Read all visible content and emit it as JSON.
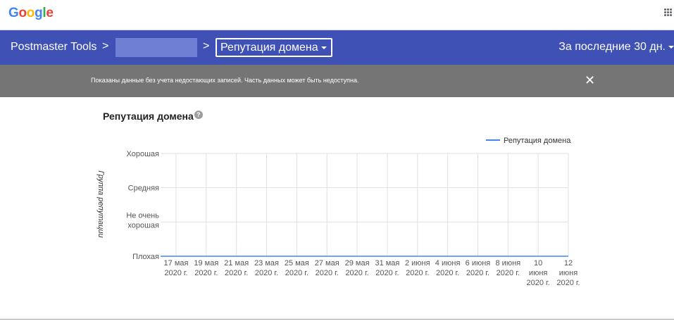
{
  "header": {
    "logo_text": "Google",
    "apps_icon": "apps-grid-icon"
  },
  "nav": {
    "app_name": "Postmaster Tools",
    "separator": ">",
    "domain_value": "",
    "section_label": "Репутация домена",
    "period_label": "За последние 30 дн."
  },
  "banner": {
    "message": "Показаны данные без учета недостающих записей. Часть данных может быть недоступна.",
    "close_symbol": "✕"
  },
  "chart_title": "Репутация домена",
  "help_symbol": "?",
  "chart_data": {
    "type": "line",
    "title": "Репутация домена",
    "ylabel": "Группа репутации",
    "xlabel": "",
    "legend": {
      "position": "top-right",
      "entries": [
        "Репутация домена"
      ]
    },
    "y_categories": [
      "Плохая",
      "Не очень хорошая",
      "Средняя",
      "Хорошая"
    ],
    "y_ticks": [
      {
        "lines": [
          "Хорошая"
        ]
      },
      {
        "lines": [
          "Средняя"
        ]
      },
      {
        "lines": [
          "Не очень",
          "хорошая"
        ]
      },
      {
        "lines": [
          "Плохая"
        ]
      }
    ],
    "x_ticks": [
      [
        "17 мая",
        "2020 г."
      ],
      [
        "19 мая",
        "2020 г."
      ],
      [
        "21 мая",
        "2020 г."
      ],
      [
        "23 мая",
        "2020 г."
      ],
      [
        "25 мая",
        "2020 г."
      ],
      [
        "27 мая",
        "2020 г."
      ],
      [
        "29 мая",
        "2020 г."
      ],
      [
        "31 мая",
        "2020 г."
      ],
      [
        "2 июня",
        "2020 г."
      ],
      [
        "4 июня",
        "2020 г."
      ],
      [
        "6 июня",
        "2020 г."
      ],
      [
        "8 июня",
        "2020 г."
      ],
      [
        "10",
        "июня",
        "2020 г."
      ],
      [
        "12",
        "июня",
        "2020 г."
      ]
    ],
    "series": [
      {
        "name": "Репутация домена",
        "color": "#4285f4",
        "x": [
          "17 мая 2020 г.",
          "12 июня 2020 г."
        ],
        "values": [
          "Плохая",
          "Плохая"
        ]
      }
    ],
    "grid": true
  }
}
